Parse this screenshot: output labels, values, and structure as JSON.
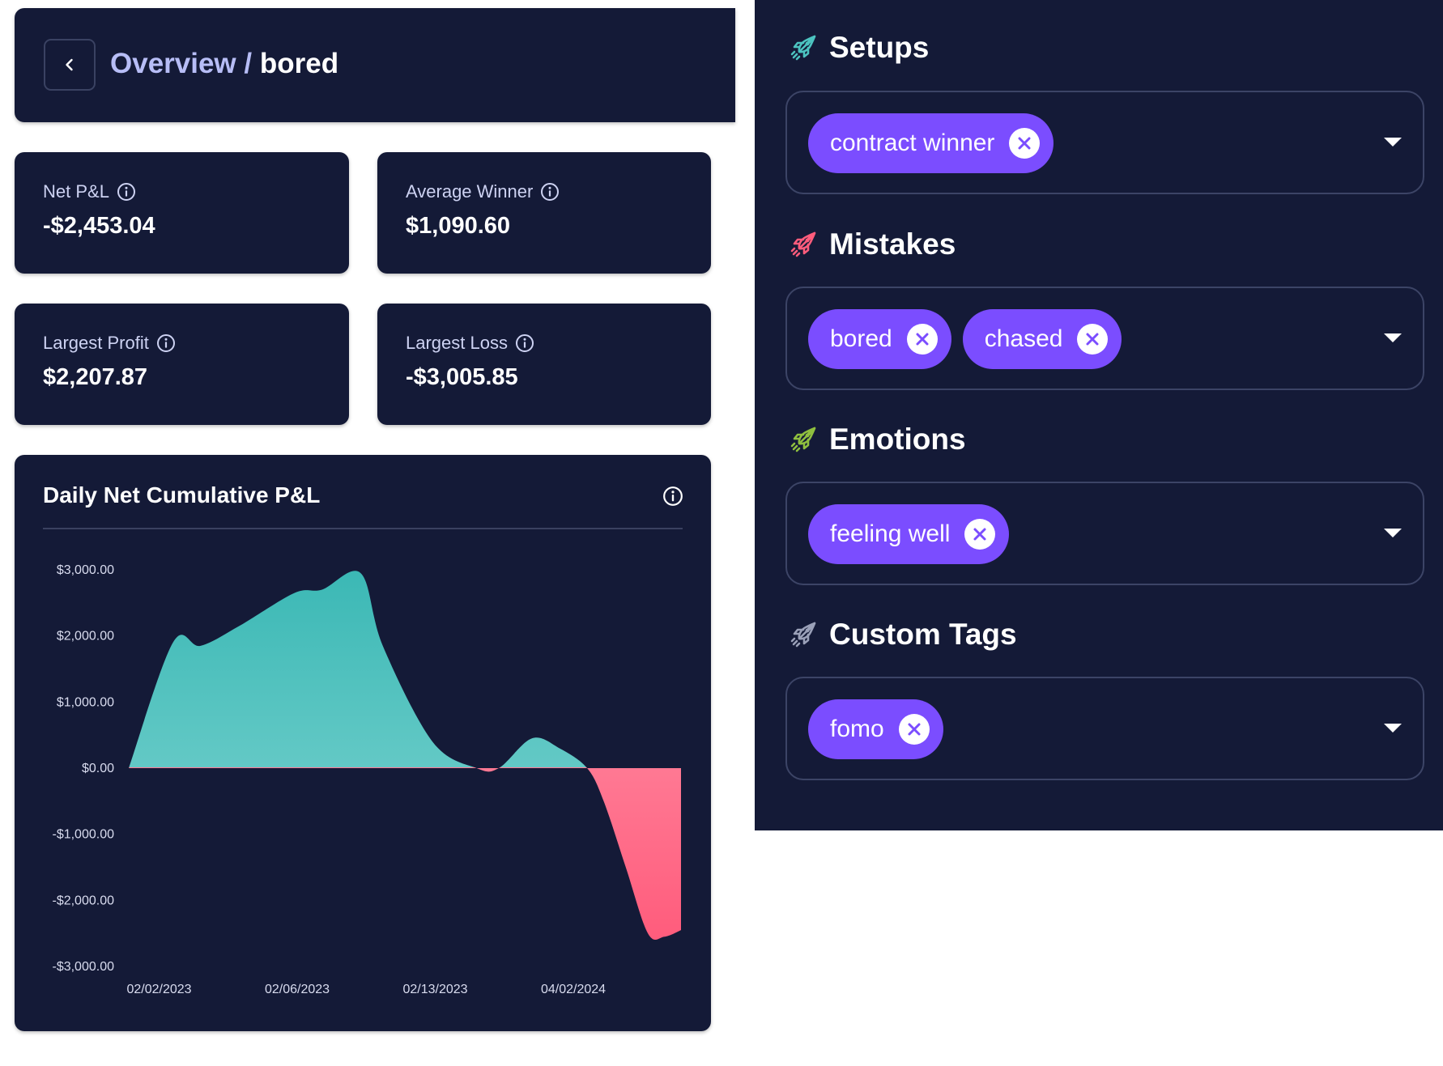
{
  "header": {
    "breadcrumb_root": "Overview",
    "breadcrumb_sep": " / ",
    "breadcrumb_leaf": "bored"
  },
  "stats": [
    {
      "label": "Net P&L",
      "value": "-$2,453.04"
    },
    {
      "label": "Average Winner",
      "value": "$1,090.60"
    },
    {
      "label": "Largest Profit",
      "value": "$2,207.87"
    },
    {
      "label": "Largest Loss",
      "value": "-$3,005.85"
    }
  ],
  "chart": {
    "title": "Daily Net Cumulative P&L"
  },
  "chart_data": {
    "type": "area",
    "title": "Daily Net Cumulative P&L",
    "x_tick_labels": [
      "02/02/2023",
      "02/06/2023",
      "02/13/2023",
      "04/02/2024"
    ],
    "y_tick_labels": [
      "$3,000.00",
      "$2,000.00",
      "$1,000.00",
      "$0.00",
      "-$1,000.00",
      "-$2,000.00",
      "-$3,000.00"
    ],
    "ylim": [
      -3000,
      3000
    ],
    "positive_color": "#4cc3c0",
    "negative_color": "#ff6b8b",
    "x": [
      0,
      0.08,
      0.13,
      0.2,
      0.3,
      0.35,
      0.42,
      0.46,
      0.55,
      0.63,
      0.67,
      0.73,
      0.78,
      0.83,
      0.86,
      0.9,
      0.94,
      0.97,
      1
    ],
    "y": [
      0,
      1900,
      1850,
      2150,
      2650,
      2700,
      2950,
      1850,
      400,
      0,
      0,
      450,
      300,
      0,
      -500,
      -1500,
      -2500,
      -2550,
      -2450
    ]
  },
  "panel": {
    "sections": [
      {
        "key": "setups",
        "title": "Setups",
        "icon_color": "#4cc3c0",
        "chips": [
          "contract winner"
        ]
      },
      {
        "key": "mistakes",
        "title": "Mistakes",
        "icon_color": "#ff5c7c",
        "chips": [
          "bored",
          "chased"
        ]
      },
      {
        "key": "emotions",
        "title": "Emotions",
        "icon_color": "#8fbf3f",
        "chips": [
          "feeling well"
        ]
      },
      {
        "key": "custom-tags",
        "title": "Custom Tags",
        "icon_color": "#9aa0b8",
        "chips": [
          "fomo"
        ]
      }
    ]
  },
  "icons": {
    "back": "chevron-left-icon",
    "info": "info-icon",
    "remove": "close-circle-icon",
    "dropdown": "caret-down-icon",
    "section": "rocket-icon"
  }
}
